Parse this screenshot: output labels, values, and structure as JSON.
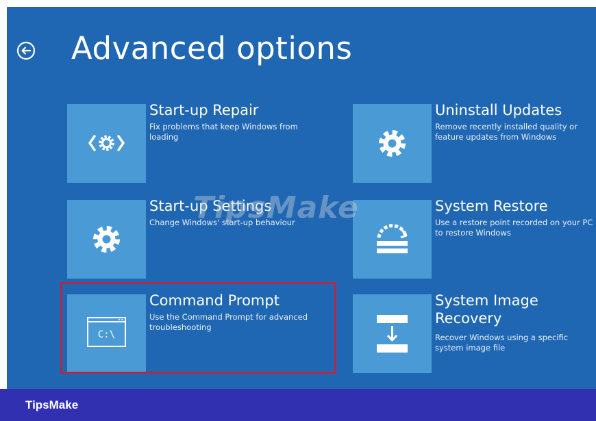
{
  "screen": {
    "title": "Advanced options",
    "back_icon": "back-arrow-icon"
  },
  "tiles": [
    {
      "title": "Start-up Repair",
      "description": "Fix problems that keep Windows from loading",
      "icon": "code-gear-icon"
    },
    {
      "title": "Uninstall Updates",
      "description": "Remove recently installed quality or feature updates from Windows",
      "icon": "gear-icon"
    },
    {
      "title": "Start-up Settings",
      "description": "Change Windows' start-up behaviour",
      "icon": "gear-icon"
    },
    {
      "title": "System Restore",
      "description": "Use a restore point recorded on your PC to restore Windows",
      "icon": "restore-icon"
    },
    {
      "title": "Command Prompt",
      "description": "Use the Command Prompt for advanced troubleshooting",
      "icon": "command-prompt-icon",
      "prompt_text": "C:\\"
    },
    {
      "title": "System Image Recovery",
      "description": "Recover Windows using a specific system image file",
      "icon": "image-recovery-icon"
    }
  ],
  "watermark": "TipsMake",
  "footer": {
    "brand": "TipsMake"
  },
  "colors": {
    "background": "#2067b3",
    "tile": "#4a9ad6",
    "highlight": "#b22a44",
    "footer": "#3030b0"
  }
}
